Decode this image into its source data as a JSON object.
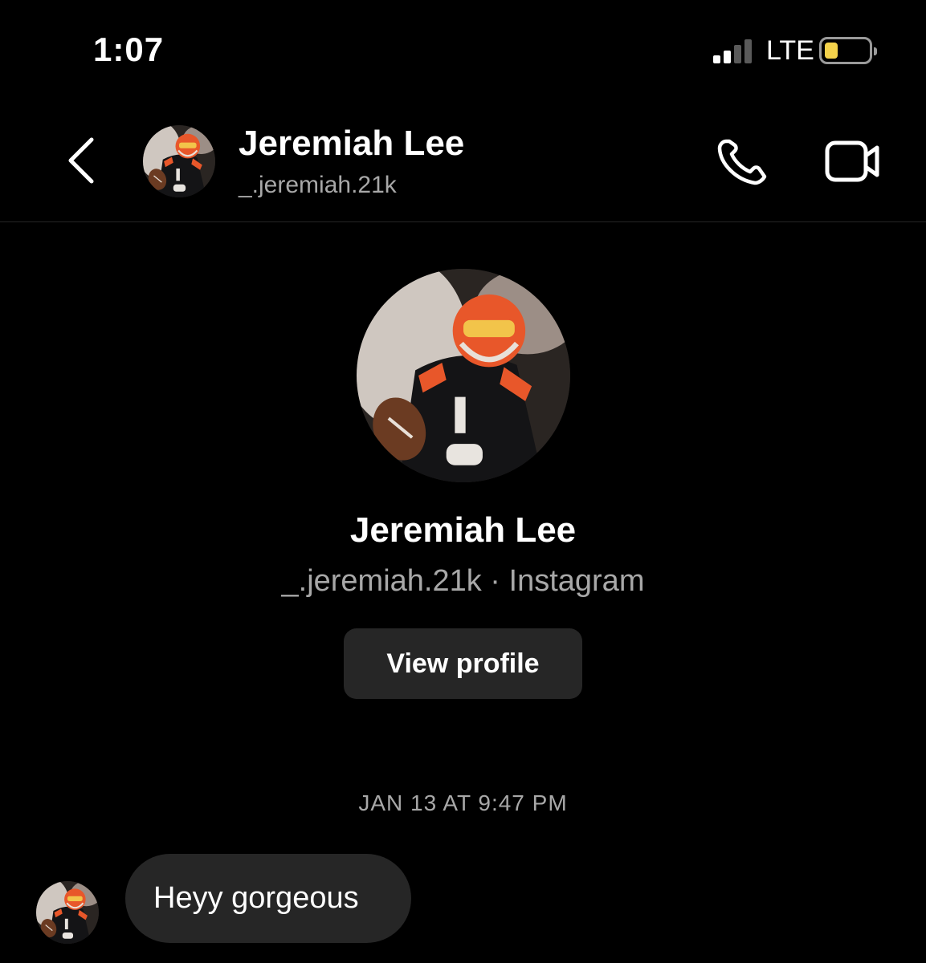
{
  "status_bar": {
    "time": "1:07",
    "network": "LTE",
    "battery_level": 0.3,
    "signal_bars_active": 2,
    "signal_bars_total": 4,
    "battery_color": "#f4d24b"
  },
  "header": {
    "back_icon": "chevron-left-icon",
    "name": "Jeremiah Lee",
    "handle": "_.jeremiah.21k",
    "call_icon": "phone-icon",
    "video_icon": "video-camera-icon"
  },
  "profile": {
    "name": "Jeremiah Lee",
    "meta": "_.jeremiah.21k · Instagram",
    "view_profile_label": "View profile"
  },
  "conversation": {
    "timestamp": "JAN 13 AT 9:47 PM",
    "messages": [
      {
        "text": "Heyy gorgeous",
        "direction": "incoming"
      }
    ]
  },
  "colors": {
    "background": "#000000",
    "bubble": "#262626",
    "secondary_text": "#a8a8a8",
    "jersey_accent": "#e8572a"
  }
}
